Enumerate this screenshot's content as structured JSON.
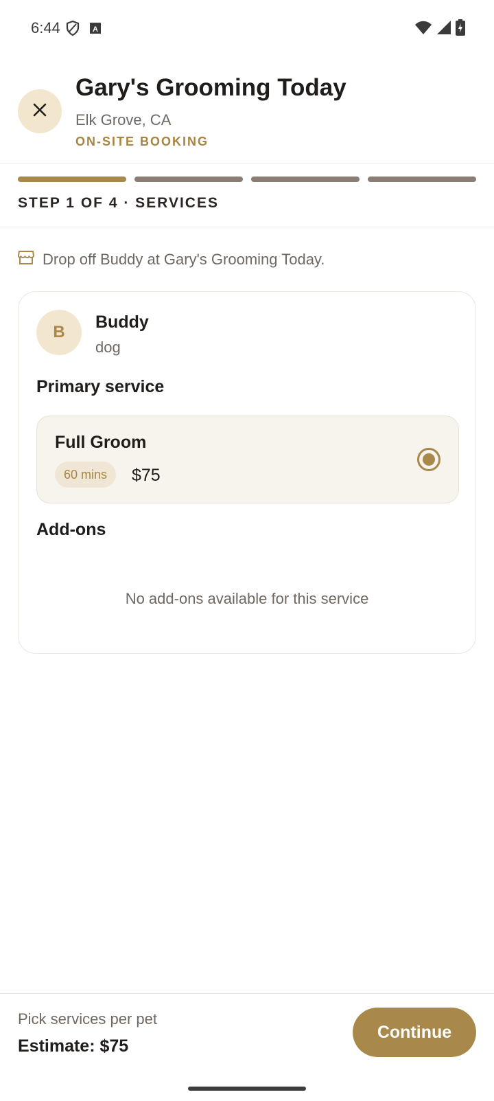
{
  "status_bar": {
    "time": "6:44",
    "left_icons": [
      "shield-icon",
      "keyboard-icon"
    ],
    "right_icons": [
      "wifi-icon",
      "signal-icon",
      "battery-charging-icon"
    ]
  },
  "header": {
    "close_icon": "close-icon",
    "title": "Gary's Grooming Today",
    "location": "Elk Grove, CA",
    "tag": "ON-SITE BOOKING"
  },
  "progress": {
    "current_step": 1,
    "total_steps": 4,
    "label": "STEP 1 OF 4 · SERVICES"
  },
  "dropoff": {
    "icon": "store-icon",
    "text": "Drop off Buddy at Gary's Grooming Today."
  },
  "pet": {
    "initial": "B",
    "name": "Buddy",
    "type": "dog"
  },
  "primary_service": {
    "section_title": "Primary service",
    "name": "Full Groom",
    "duration": "60 mins",
    "price": "$75",
    "selected": true
  },
  "addons": {
    "section_title": "Add-ons",
    "empty_text": "No add-ons available for this service"
  },
  "footer": {
    "hint": "Pick services per pet",
    "estimate": "Estimate: $75",
    "continue_label": "Continue"
  },
  "colors": {
    "accent": "#a8894b",
    "accent_light": "#f3e6cf",
    "inactive_step": "#8c7d74",
    "text_primary": "#1f1c1a",
    "text_secondary": "#6f6862"
  }
}
